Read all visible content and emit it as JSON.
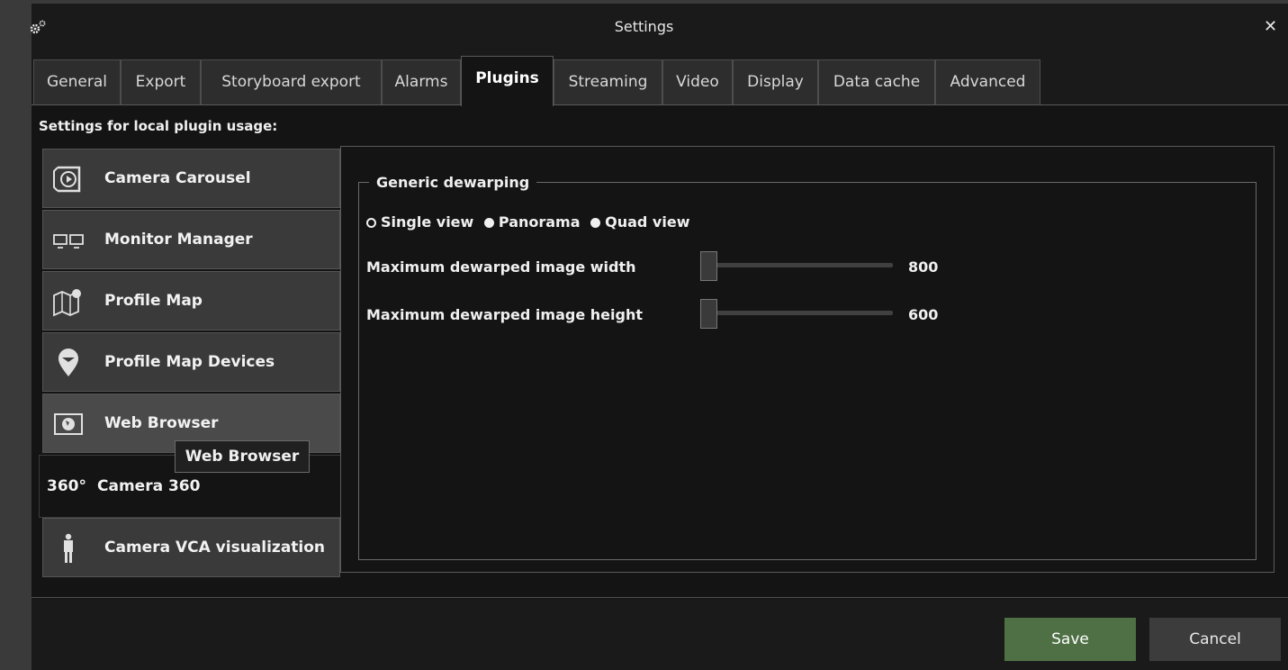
{
  "window": {
    "title": "Settings",
    "close_glyph": "✕"
  },
  "tabs": [
    {
      "label": "General"
    },
    {
      "label": "Export"
    },
    {
      "label": "Storyboard export"
    },
    {
      "label": "Alarms"
    },
    {
      "label": "Plugins"
    },
    {
      "label": "Streaming"
    },
    {
      "label": "Video"
    },
    {
      "label": "Display"
    },
    {
      "label": "Data cache"
    },
    {
      "label": "Advanced"
    }
  ],
  "active_tab": "Plugins",
  "section_label": "Settings for local plugin usage:",
  "plugins": [
    {
      "label": "Camera Carousel",
      "icon": "camera-carousel-icon"
    },
    {
      "label": "Monitor Manager",
      "icon": "monitor-manager-icon"
    },
    {
      "label": "Profile Map",
      "icon": "profile-map-icon"
    },
    {
      "label": "Profile Map Devices",
      "icon": "map-pin-icon"
    },
    {
      "label": "Web Browser",
      "icon": "web-browser-icon"
    },
    {
      "label": "Camera 360",
      "icon": "camera-360-icon",
      "icon_text": "360°"
    },
    {
      "label": "Camera VCA visualization",
      "icon": "person-icon"
    }
  ],
  "selected_plugin": "Camera 360",
  "tooltip": "Web Browser",
  "group": {
    "title": "Generic dewarping",
    "radios": [
      {
        "label": "Single view",
        "checked": true
      },
      {
        "label": "Panorama",
        "checked": false
      },
      {
        "label": "Quad view",
        "checked": false
      }
    ],
    "width_label": "Maximum dewarped image width",
    "width_value": "800",
    "height_label": "Maximum dewarped image height",
    "height_value": "600"
  },
  "buttons": {
    "save": "Save",
    "cancel": "Cancel"
  },
  "colors": {
    "save": "#4f7044",
    "background": "#141414"
  }
}
